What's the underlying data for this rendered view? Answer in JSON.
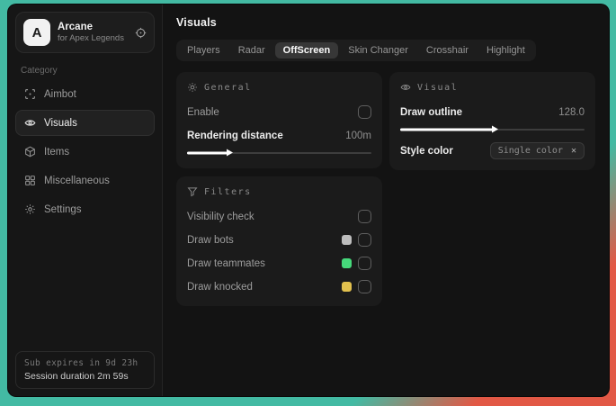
{
  "background": {
    "teal": "#43BAA3",
    "red": "#E25845"
  },
  "sidebar": {
    "logo": {
      "letter": "A",
      "title": "Arcane",
      "subtitle": "for Apex Legends",
      "icon": "target-icon"
    },
    "category_label": "Category",
    "items": [
      {
        "label": "Aimbot",
        "icon": "crosshair-icon"
      },
      {
        "label": "Visuals",
        "icon": "eye-scan-icon"
      },
      {
        "label": "Items",
        "icon": "box-icon"
      },
      {
        "label": "Miscellaneous",
        "icon": "grid-icon"
      },
      {
        "label": "Settings",
        "icon": "gear-icon"
      }
    ],
    "selected_item": "Visuals",
    "footer": {
      "sub_expires": "Sub expires in 9d 23h",
      "session_duration": "Session duration 2m 59s"
    }
  },
  "main": {
    "title": "Visuals",
    "tabs": [
      {
        "label": "Players",
        "selected": false
      },
      {
        "label": "Radar",
        "selected": false
      },
      {
        "label": "OffScreen",
        "selected": true
      },
      {
        "label": "Skin Changer",
        "selected": false
      },
      {
        "label": "Crosshair",
        "selected": false
      },
      {
        "label": "Highlight",
        "selected": false
      }
    ],
    "panels": {
      "general": {
        "title": "General",
        "icon": "gear-sun-icon",
        "enable_label": "Enable",
        "enable_checked": false,
        "rendering_distance_label": "Rendering distance",
        "rendering_distance_value": "100m",
        "rendering_distance_fill_pct": 22
      },
      "filters": {
        "title": "Filters",
        "icon": "funnel-icon",
        "rows": [
          {
            "label": "Visibility check",
            "checked": false
          },
          {
            "label": "Draw bots",
            "swatch": "#BDBDBD",
            "checked": false
          },
          {
            "label": "Draw teammates",
            "swatch": "#46D97B",
            "checked": false
          },
          {
            "label": "Draw knocked",
            "swatch": "#E2C14E",
            "checked": false
          }
        ]
      },
      "visual": {
        "title": "Visual",
        "icon": "eye-icon",
        "draw_outline_label": "Draw outline",
        "draw_outline_value": "128.0",
        "draw_outline_fill_pct": 50,
        "style_color_label": "Style color",
        "style_color_value": "Single color",
        "style_color_clear": "✕"
      }
    }
  }
}
